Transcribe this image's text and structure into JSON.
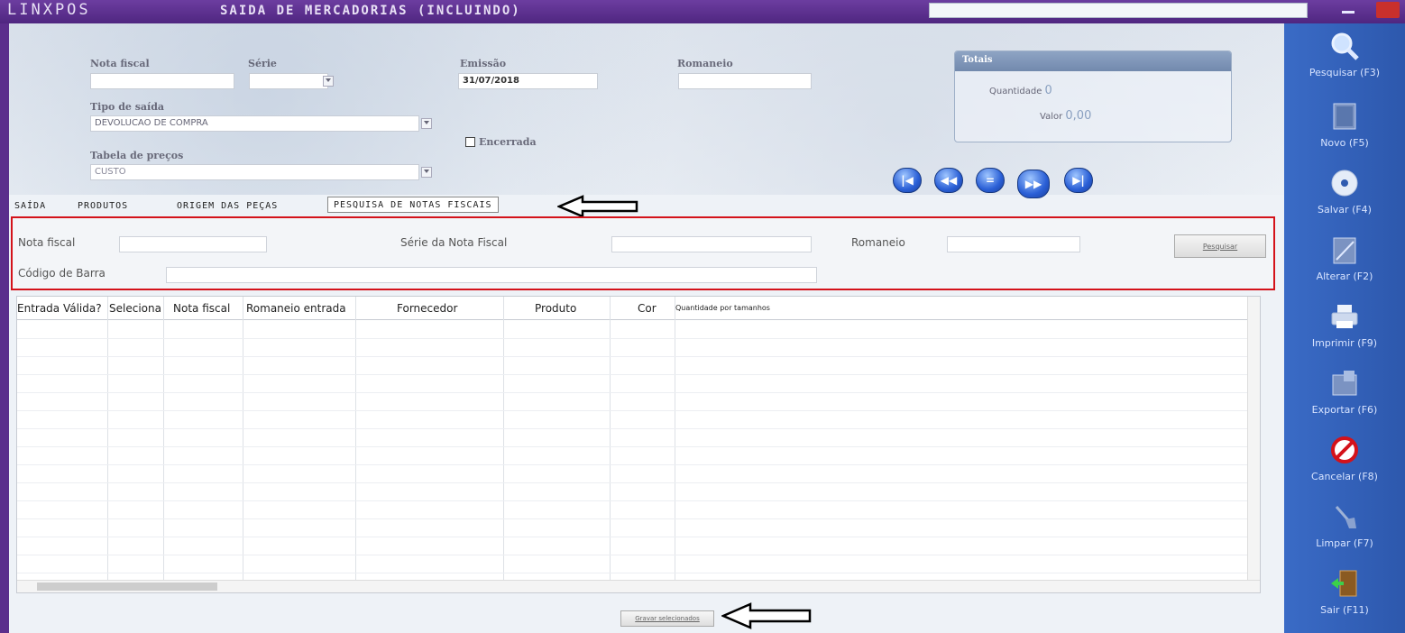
{
  "window": {
    "app_name": "LINXPOS",
    "title": "SAIDA DE MERCADORIAS (INCLUINDO)"
  },
  "header": {
    "nota_fiscal_label": "Nota fiscal",
    "nota_fiscal_value": "",
    "serie_label": "Série",
    "serie_value": "",
    "emissao_label": "Emissão",
    "emissao_value": "31/07/2018",
    "romaneio_label": "Romaneio",
    "romaneio_value": "",
    "tipo_saida_label": "Tipo de saída",
    "tipo_saida_value": "DEVOLUCAO DE COMPRA",
    "tabela_precos_label": "Tabela de preços",
    "tabela_precos_value": "CUSTO",
    "encerrada_label": "Encerrada",
    "encerrada_checked": false
  },
  "totals": {
    "title": "Totais",
    "quantidade_label": "Quantidade",
    "quantidade_value": "0",
    "valor_label": "Valor",
    "valor_value": "0,00"
  },
  "nav_buttons": [
    "first",
    "previous",
    "current",
    "next",
    "last"
  ],
  "tabs": [
    {
      "label": "SAÍDA",
      "active": false
    },
    {
      "label": "PRODUTOS",
      "active": false
    },
    {
      "label": "ORIGEM DAS PEÇAS",
      "active": false
    },
    {
      "label": "PESQUISA DE NOTAS FISCAIS",
      "active": true
    }
  ],
  "search": {
    "nota_fiscal_label": "Nota fiscal",
    "serie_label": "Série da Nota Fiscal",
    "romaneio_label": "Romaneio",
    "codigo_barra_label": "Código de Barra",
    "pesquisar_button": "Pesquisar"
  },
  "grid": {
    "columns": [
      "Entrada Válida?",
      "Seleciona",
      "Nota fiscal",
      "Romaneio entrada",
      "Fornecedor",
      "Produto",
      "Cor",
      "Quantidade por tamanhos"
    ],
    "rows": []
  },
  "footer": {
    "gravar_button": "Gravar selecionados"
  },
  "toolbar": {
    "pesquisar": "Pesquisar (F3)",
    "novo": "Novo (F5)",
    "salvar": "Salvar (F4)",
    "alterar": "Alterar (F2)",
    "imprimir": "Imprimir (F9)",
    "exportar": "Exportar (F6)",
    "cancelar": "Cancelar (F8)",
    "limpar": "Limpar (F7)",
    "sair": "Sair (F11)"
  },
  "colors": {
    "title_bar": "#5b2e8c",
    "toolbar": "#3a6bc6",
    "highlight_border": "#d4121a"
  }
}
